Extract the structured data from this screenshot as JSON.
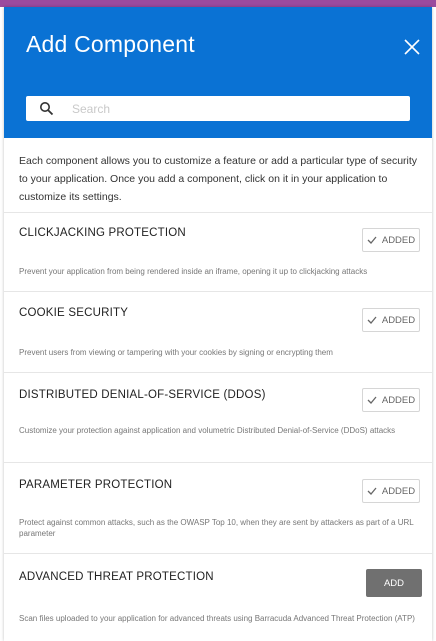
{
  "panel": {
    "title": "Add Component",
    "close_icon": "close-icon"
  },
  "search": {
    "placeholder": "Search",
    "value": "",
    "icon": "search-icon"
  },
  "intro": "Each component allows you to customize a feature or add a particular type of security to your application. Once you add a component, click on it in your application to customize its settings.",
  "components": [
    {
      "name": "CLICKJACKING PROTECTION",
      "description": "Prevent your application from being rendered inside an iframe, opening it up to clickjacking attacks",
      "status": "ADDED"
    },
    {
      "name": "COOKIE SECURITY",
      "description": "Prevent users from viewing or tampering with your cookies by signing or encrypting them",
      "status": "ADDED"
    },
    {
      "name": "DISTRIBUTED DENIAL-OF-SERVICE (DDOS)",
      "description": "Customize your protection against application and volumetric Distributed Denial-of-Service (DDoS) attacks",
      "status": "ADDED"
    },
    {
      "name": "PARAMETER PROTECTION",
      "description": "Protect against common attacks, such as the OWASP Top 10, when they are sent by attackers as part of a URL parameter",
      "status": "ADDED"
    },
    {
      "name": "ADVANCED THREAT PROTECTION",
      "description": "Scan files uploaded to your application for advanced threats using Barracuda Advanced Threat Protection (ATP)",
      "status": "ADD"
    }
  ],
  "colors": {
    "accent": "#9b4a9e",
    "header": "#0a72d4",
    "add_button": "#707070"
  }
}
